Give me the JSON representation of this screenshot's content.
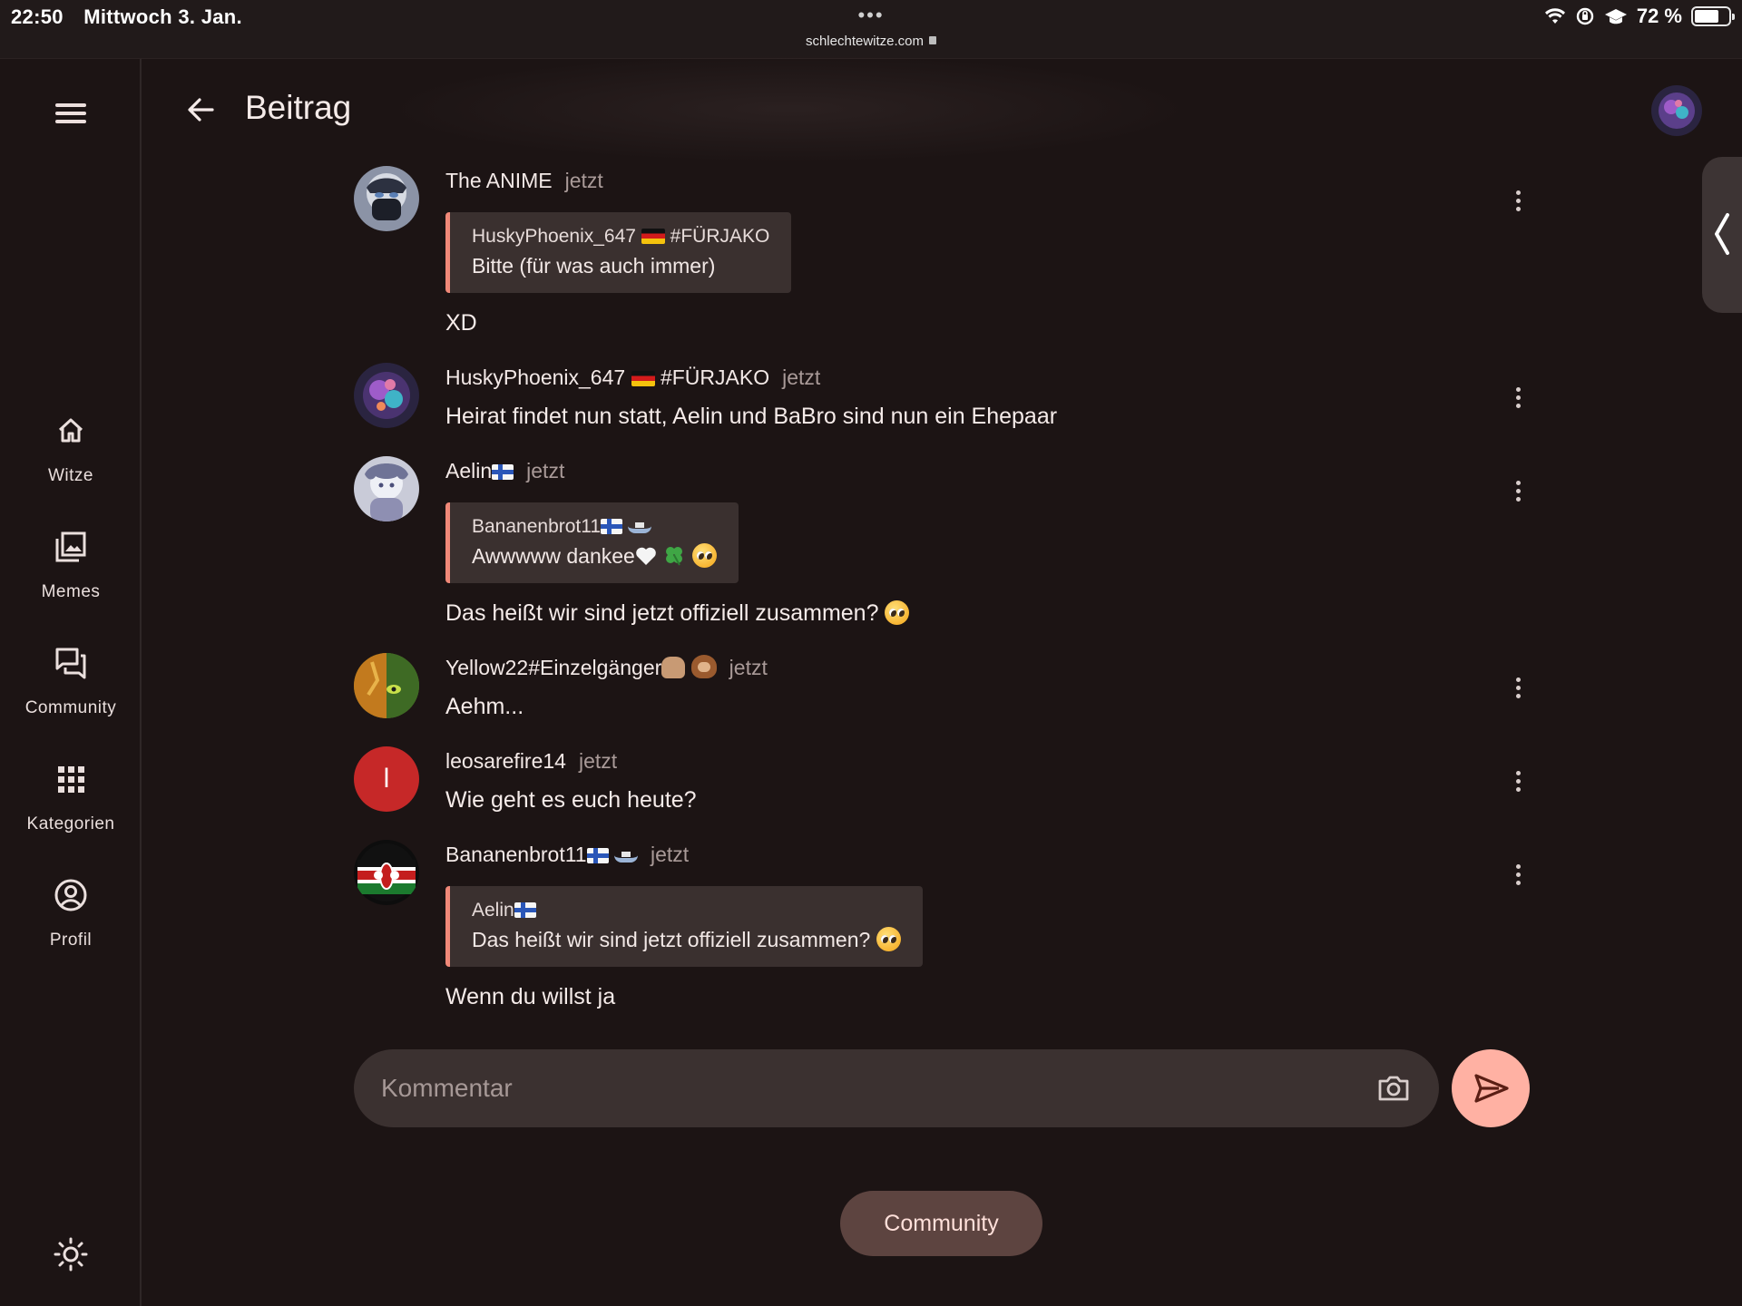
{
  "statusbar": {
    "time": "22:50",
    "date": "Mittwoch 3. Jan.",
    "dots": "•••",
    "url": "schlechtewitze.com",
    "battery": "72 %",
    "battery_level": 0.72
  },
  "nav": {
    "items": [
      {
        "label": "Witze",
        "icon": "home-icon"
      },
      {
        "label": "Memes",
        "icon": "image-gallery-icon"
      },
      {
        "label": "Community",
        "icon": "forum-icon"
      },
      {
        "label": "Kategorien",
        "icon": "grid-icon"
      },
      {
        "label": "Profil",
        "icon": "account-circle-icon"
      }
    ]
  },
  "header": {
    "title": "Beitrag"
  },
  "posts": [
    {
      "author": "The ANIME",
      "time": "jetzt",
      "quote": {
        "author": "HuskyPhoenix_647",
        "author_suffix": "#FÜRJAKO",
        "text": "Bitte (für was auch immer)"
      },
      "text": "XD"
    },
    {
      "author": "HuskyPhoenix_647",
      "author_suffix": "#FÜRJAKO",
      "time": "jetzt",
      "text": "Heirat findet nun statt, Aelin und BaBro sind nun ein Ehepaar"
    },
    {
      "author": "Aelin",
      "time": "jetzt",
      "quote": {
        "author": "Bananenbrot11",
        "text": "Awwwww dankee"
      },
      "text": "Das heißt wir sind jetzt offiziell zusammen?"
    },
    {
      "author": "Yellow22#Einzelgänger",
      "time": "jetzt",
      "text": "Aehm..."
    },
    {
      "author": "leosarefire14",
      "avatar_letter": "l",
      "avatar_color": "#c62828",
      "time": "jetzt",
      "text": "Wie geht es euch heute?"
    },
    {
      "author": "Bananenbrot11",
      "time": "jetzt",
      "quote": {
        "author": "Aelin",
        "text": "Das heißt wir sind jetzt offiziell zusammen?"
      },
      "text": "Wenn du willst ja"
    }
  ],
  "comment": {
    "placeholder": "Kommentar"
  },
  "footer": {
    "community_label": "Community"
  },
  "colors": {
    "accent": "#ffb1a3",
    "quote_bar": "#f08878",
    "background": "#1c1414"
  }
}
